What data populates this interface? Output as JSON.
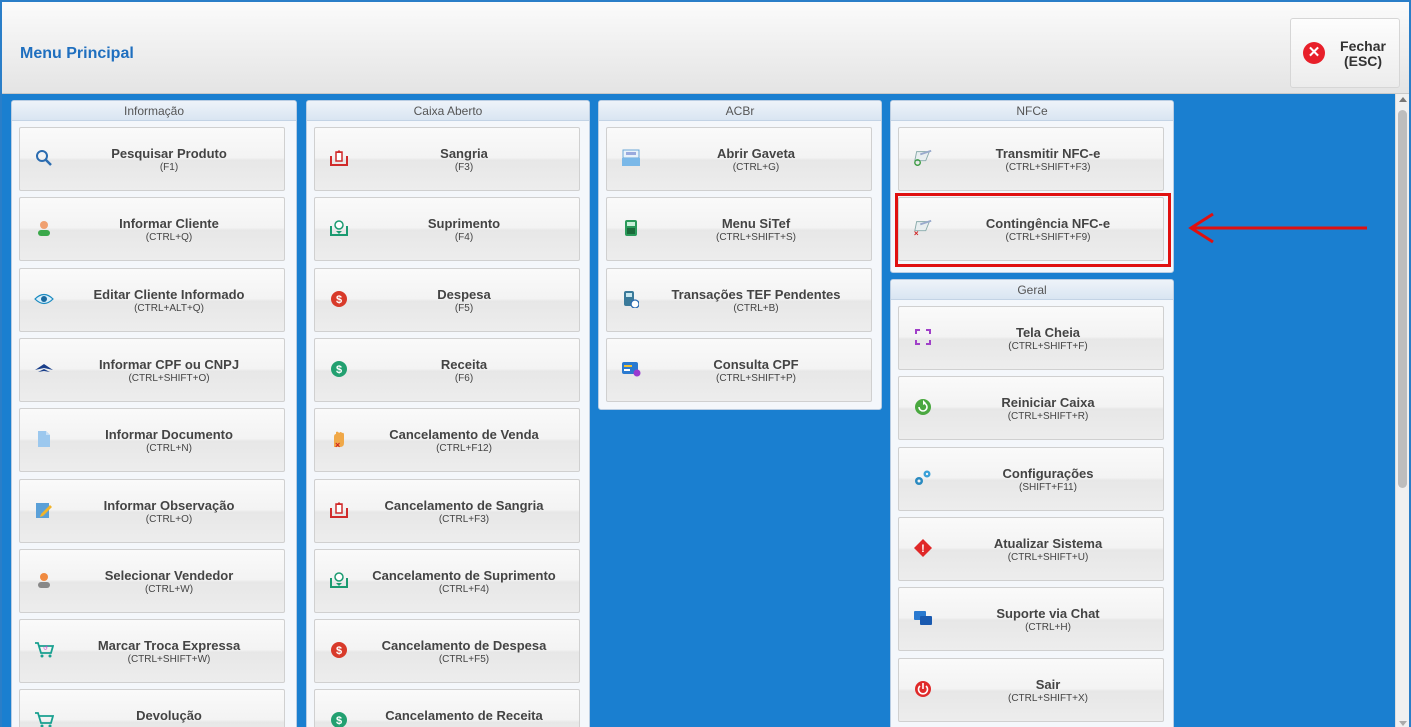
{
  "header": {
    "title": "Menu Principal",
    "close_label": "Fechar\n(ESC)"
  },
  "panels": {
    "informacao": {
      "title": "Informação",
      "items": [
        {
          "label": "Pesquisar Produto",
          "shortcut": "(F1)",
          "icon": "search-icon"
        },
        {
          "label": "Informar Cliente",
          "shortcut": "(CTRL+Q)",
          "icon": "user-icon"
        },
        {
          "label": "Editar Cliente Informado",
          "shortcut": "(CTRL+ALT+Q)",
          "icon": "eye-icon"
        },
        {
          "label": "Informar CPF ou CNPJ",
          "shortcut": "(CTRL+SHIFT+O)",
          "icon": "receita-federal-icon"
        },
        {
          "label": "Informar Documento",
          "shortcut": "(CTRL+N)",
          "icon": "document-icon"
        },
        {
          "label": "Informar Observação",
          "shortcut": "(CTRL+O)",
          "icon": "note-edit-icon"
        },
        {
          "label": "Selecionar Vendedor",
          "shortcut": "(CTRL+W)",
          "icon": "seller-icon"
        },
        {
          "label": "Marcar Troca Expressa",
          "shortcut": "(CTRL+SHIFT+W)",
          "icon": "cart-exchange-icon"
        },
        {
          "label": "Devolução",
          "shortcut": "",
          "icon": "cart-return-icon"
        }
      ]
    },
    "caixa": {
      "title": "Caixa Aberto",
      "items": [
        {
          "label": "Sangria",
          "shortcut": "(F3)",
          "icon": "cash-out-icon"
        },
        {
          "label": "Suprimento",
          "shortcut": "(F4)",
          "icon": "cash-in-icon"
        },
        {
          "label": "Despesa",
          "shortcut": "(F5)",
          "icon": "expense-icon"
        },
        {
          "label": "Receita",
          "shortcut": "(F6)",
          "icon": "revenue-icon"
        },
        {
          "label": "Cancelamento de Venda",
          "shortcut": "(CTRL+F12)",
          "icon": "cancel-hand-icon"
        },
        {
          "label": "Cancelamento de Sangria",
          "shortcut": "(CTRL+F3)",
          "icon": "cash-out-icon"
        },
        {
          "label": "Cancelamento de Suprimento",
          "shortcut": "(CTRL+F4)",
          "icon": "cash-in-icon"
        },
        {
          "label": "Cancelamento de Despesa",
          "shortcut": "(CTRL+F5)",
          "icon": "expense-icon"
        },
        {
          "label": "Cancelamento de Receita",
          "shortcut": "",
          "icon": "revenue-icon"
        }
      ]
    },
    "acbr": {
      "title": "ACBr",
      "items": [
        {
          "label": "Abrir Gaveta",
          "shortcut": "(CTRL+G)",
          "icon": "cash-drawer-icon"
        },
        {
          "label": "Menu SiTef",
          "shortcut": "(CTRL+SHIFT+S)",
          "icon": "card-terminal-icon"
        },
        {
          "label": "Transações TEF Pendentes",
          "shortcut": "(CTRL+B)",
          "icon": "pending-terminal-icon"
        },
        {
          "label": "Consulta CPF",
          "shortcut": "(CTRL+SHIFT+P)",
          "icon": "id-card-icon"
        }
      ]
    },
    "nfce": {
      "title": "NFCe",
      "items": [
        {
          "label": "Transmitir NFC-e",
          "shortcut": "(CTRL+SHIFT+F3)",
          "icon": "nfce-transmit-icon"
        },
        {
          "label": "Contingência NFC-e",
          "shortcut": "(CTRL+SHIFT+F9)",
          "icon": "nfce-contingency-icon"
        }
      ]
    },
    "geral": {
      "title": "Geral",
      "items": [
        {
          "label": "Tela Cheia",
          "shortcut": "(CTRL+SHIFT+F)",
          "icon": "fullscreen-icon"
        },
        {
          "label": "Reiniciar Caixa",
          "shortcut": "(CTRL+SHIFT+R)",
          "icon": "restart-icon"
        },
        {
          "label": "Configurações",
          "shortcut": "(SHIFT+F11)",
          "icon": "gears-icon"
        },
        {
          "label": "Atualizar Sistema",
          "shortcut": "(CTRL+SHIFT+U)",
          "icon": "update-alert-icon"
        },
        {
          "label": "Suporte via Chat",
          "shortcut": "(CTRL+H)",
          "icon": "chat-icon"
        },
        {
          "label": "Sair",
          "shortcut": "(CTRL+SHIFT+X)",
          "icon": "power-icon"
        }
      ]
    }
  },
  "colors": {
    "accent": "#1a7fd0",
    "title": "#1f6fbf",
    "highlight": "#e01010"
  }
}
